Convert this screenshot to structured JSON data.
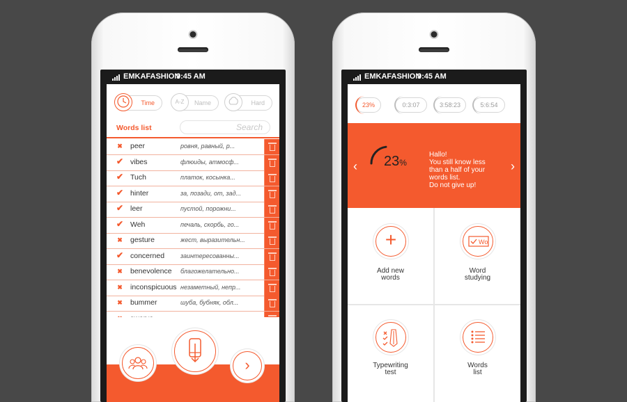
{
  "status_bar": {
    "carrier": "EMKAFASHION",
    "time": "9:45 AM"
  },
  "left_app": {
    "sort_options": [
      {
        "label": "Time",
        "icon": "clock-icon",
        "active": true
      },
      {
        "label": "Name",
        "icon": "a-z-icon",
        "icon_text": "A-Z",
        "active": false
      },
      {
        "label": "Hard",
        "icon": "brain-icon",
        "active": false
      }
    ],
    "words_list_title": "Words list",
    "search_placeholder": "Search",
    "words": [
      {
        "word": "peer",
        "translation": "ровня, равный, р...",
        "status": "wrong"
      },
      {
        "word": "vibes",
        "translation": "флюиды, атмосф...",
        "status": "correct"
      },
      {
        "word": "Tuch",
        "translation": "платок, косынка...",
        "status": "correct"
      },
      {
        "word": "hinter",
        "translation": "за, позади, от, зад...",
        "status": "correct"
      },
      {
        "word": "leer",
        "translation": "пустой, порожни...",
        "status": "correct"
      },
      {
        "word": "Weh",
        "translation": "печаль, скорбь, го...",
        "status": "correct"
      },
      {
        "word": "gesture",
        "translation": "жест, выразительн...",
        "status": "wrong"
      },
      {
        "word": "concerned",
        "translation": "заинтересованны...",
        "status": "correct"
      },
      {
        "word": "benevolence",
        "translation": "благожелательно...",
        "status": "wrong"
      },
      {
        "word": "inconspicuous",
        "translation": "незаметный, непр...",
        "status": "wrong"
      },
      {
        "word": "bummer",
        "translation": "шуба, бубняк, обл...",
        "status": "wrong"
      },
      {
        "word": "swerve",
        "translation": "вилять, откл...",
        "status": "wrong"
      }
    ],
    "bottom_actions": [
      "group-icon",
      "phone-download-icon",
      "next-arrow-icon"
    ],
    "next_glyph": "›"
  },
  "right_app": {
    "progress_tabs": [
      "23%",
      "0:3:07",
      "3:58:23",
      "5:6:54"
    ],
    "progress_value": "23",
    "progress_sign": "%",
    "progress_fraction": 0.23,
    "message_lines": [
      "Hallo!",
      "You still know less",
      "than a half of your",
      "words list.",
      "Do not give up!"
    ],
    "prev_glyph": "‹",
    "next_glyph": "›",
    "menu": [
      {
        "label_lines": [
          "Add new",
          "words"
        ],
        "icon": "plus-icon",
        "icon_glyph": "+"
      },
      {
        "label_lines": [
          "Word",
          "studying"
        ],
        "icon": "word-card-icon",
        "icon_text": "Wo"
      },
      {
        "label_lines": [
          "Typewriting",
          "test"
        ],
        "icon": "checklist-icon"
      },
      {
        "label_lines": [
          "Words",
          "list"
        ],
        "icon": "list-icon"
      }
    ]
  },
  "colors": {
    "accent": "#f45a2e",
    "background": "#484848"
  }
}
